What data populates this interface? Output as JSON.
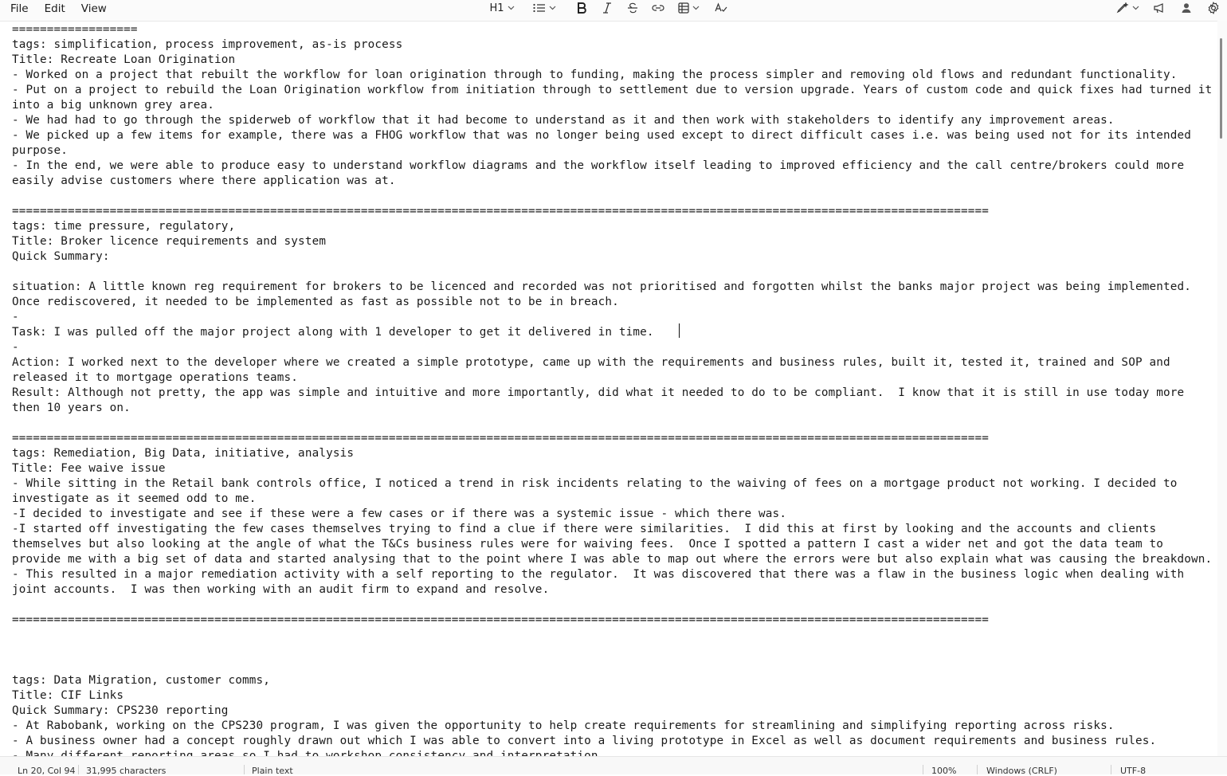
{
  "menu": {
    "file": "File",
    "edit": "Edit",
    "view": "View"
  },
  "format_toolbar": {
    "heading_label": "H1",
    "icons": [
      "list-icon",
      "bold-icon",
      "italic-icon",
      "strikethrough-icon",
      "link-icon",
      "table-icon",
      "clear-formatting-icon"
    ]
  },
  "right_toolbar": {
    "icons": [
      "copilot-pen-icon",
      "megaphone-icon",
      "account-icon",
      "settings-icon"
    ]
  },
  "document": {
    "text": "==================\ntags: simplification, process improvement, as-is process\nTitle: Recreate Loan Origination\n- Worked on a project that rebuilt the workflow for loan origination through to funding, making the process simpler and removing old flows and redundant functionality.\n- Put on a project to rebuild the Loan Origination workflow from initiation through to settlement due to version upgrade. Years of custom code and quick fixes had turned it into a big unknown grey area.\n- We had had to go through the spiderweb of workflow that it had become to understand as it and then work with stakeholders to identify any improvement areas.\n- We picked up a few items for example, there was a FHOG workflow that was no longer being used except to direct difficult cases i.e. was being used not for its intended purpose.\n- In the end, we were able to produce easy to understand workflow diagrams and the workflow itself leading to improved efficiency and the call centre/brokers could more easily advise customers where there application was at.\n\n============================================================================================================================================\ntags: time pressure, regulatory,\nTitle: Broker licence requirements and system\nQuick Summary:\n\nsituation: A little known reg requirement for brokers to be licenced and recorded was not prioritised and forgotten whilst the banks major project was being implemented.  Once rediscovered, it needed to be implemented as fast as possible not to be in breach.\n-\nTask: I was pulled off the major project along with 1 developer to get it delivered in time. \n-\nAction: I worked next to the developer where we created a simple prototype, came up with the requirements and business rules, built it, tested it, trained and SOP and released it to mortgage operations teams.\nResult: Although not pretty, the app was simple and intuitive and more importantly, did what it needed to do to be compliant.  I know that it is still in use today more then 10 years on.\n\n============================================================================================================================================\ntags: Remediation, Big Data, initiative, analysis\nTitle: Fee waive issue\n- While sitting in the Retail bank controls office, I noticed a trend in risk incidents relating to the waiving of fees on a mortgage product not working. I decided to investigate as it seemed odd to me.\n-I decided to investigate and see if these were a few cases or if there was a systemic issue - which there was.\n-I started off investigating the few cases themselves trying to find a clue if there were similarities.  I did this at first by looking and the accounts and clients themselves but also looking at the angle of what the T&Cs business rules were for waiving fees.  Once I spotted a pattern I cast a wider net and got the data team to provide me with a big set of data and started analysing that to the point where I was able to map out where the errors were but also explain what was causing the breakdown.\n- This resulted in a major remediation activity with a self reporting to the regulator.  It was discovered that there was a flaw in the business logic when dealing with joint accounts.  I was then working with an audit firm to expand and resolve.\n\n============================================================================================================================================\n\n\n\ntags: Data Migration, customer comms,\nTitle: CIF Links\nQuick Summary: CPS230 reporting\n- At Rabobank, working on the CPS230 program, I was given the opportunity to help create requirements for streamlining and simplifying reporting across risks.\n- A business owner had a concept roughly drawn out which I was able to convert into a living prototype in Excel as well as document requirements and business rules.\n- Many different reporting areas so I had to workshop consistency and interpretation"
  },
  "status_bar": {
    "position": "Ln 20, Col 94",
    "characters": "31,995 characters",
    "format": "Plain text",
    "zoom": "100%",
    "line_ending": "Windows (CRLF)",
    "encoding": "UTF-8"
  }
}
